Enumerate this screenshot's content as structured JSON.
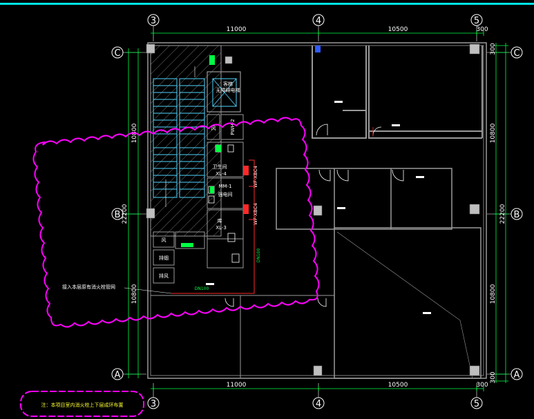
{
  "grid": {
    "col_3": "3",
    "col_4": "4",
    "col_5": "5",
    "row_c": "C",
    "row_b": "B",
    "row_a": "A"
  },
  "dimensions": {
    "top_span_1": "11000",
    "top_span_2": "10500",
    "top_edge": "300",
    "bottom_span_1": "11000",
    "bottom_span_2": "10500",
    "bottom_edge": "300",
    "left_upper": "10800",
    "left_total": "22200",
    "left_lower": "10800",
    "right_top_edge": "300",
    "right_upper": "10800",
    "right_total": "22200",
    "right_lower": "10800",
    "right_bottom_edge": "300"
  },
  "rooms": {
    "elevator_room": "客梯\n无障碍电梯",
    "shaft_label": "风",
    "shaft_pw": "PWH-2",
    "restroom_label": "卫生间",
    "xl4": "XL-4",
    "mm1": "MM-1",
    "electrical_room": "强电间",
    "shaft2_label": "WF-XBC4",
    "storage": "库",
    "xl3": "XL-3",
    "wind_1": "风",
    "wind_2": "排烟",
    "wind_3": "排风",
    "shaft3_label": "WF-XBC4"
  },
  "pipes": {
    "horizontal_len": "DN100",
    "vertical_len": "DN100",
    "connect_note": "接入本层原有消火栓管网"
  },
  "footer_note": "注：本项目室内消火栓上下层成环布置",
  "colors": {
    "background": "#000000",
    "wall": "#9a9a9a",
    "cloud": "#ff00ff",
    "stair": "#4fd6ff",
    "pipe": "#ff2a2a",
    "dim_line": "#ffffff",
    "top_bar": "#00e5e5",
    "green_dim": "#00ff44"
  }
}
